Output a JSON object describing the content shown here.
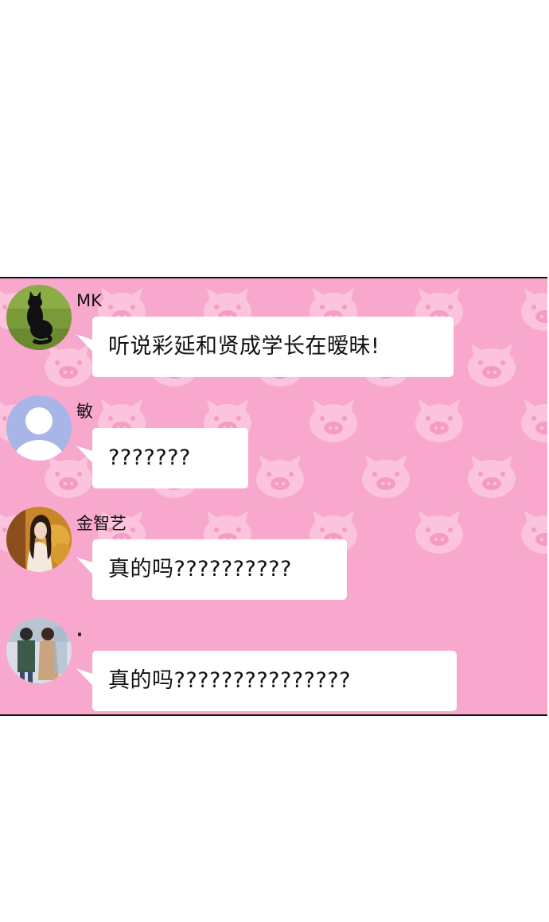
{
  "messages": [
    {
      "sender": "MK",
      "avatar": "black-cat-on-grass-avatar",
      "text": "听说彩延和贤成学长在暧昧!"
    },
    {
      "sender": "敏",
      "avatar": "default-person-avatar",
      "text": "???????"
    },
    {
      "sender": "金智艺",
      "avatar": "girl-with-flowers-avatar",
      "text": "真的吗??????????"
    },
    {
      "sender": "·",
      "avatar": "couple-photo-avatar",
      "text": "真的吗???????????????"
    }
  ],
  "colors": {
    "chat_background": "#f7a8cc",
    "pig_pattern": "#fbc3dc",
    "bubble": "#ffffff",
    "border": "#111111"
  },
  "background_pattern": "pig-face-icon"
}
